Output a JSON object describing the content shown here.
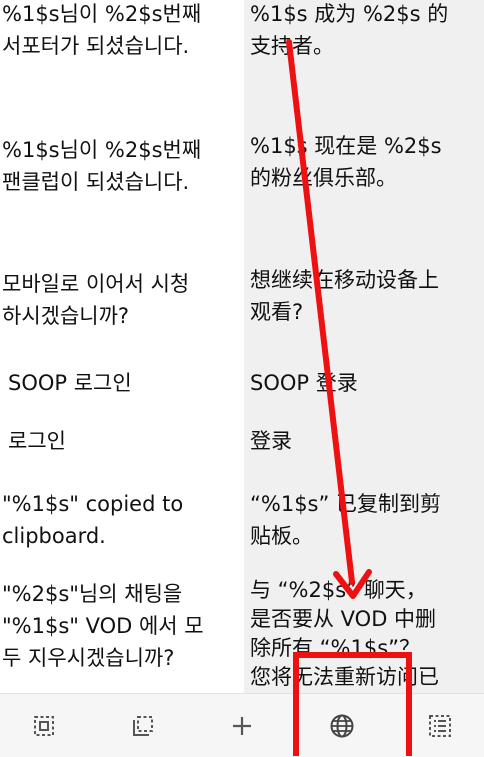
{
  "rows": [
    {
      "ko": "%1$s님이 %2$s번째\n서포터가 되셨습니다.",
      "zh": "%1$s 成为 %2$s 的\n支持者。"
    },
    {
      "ko": "%1$s님이 %2$s번째\n팬클럽이 되셨습니다.",
      "zh": "%1$s 现在是 %2$s\n的粉丝俱乐部。"
    },
    {
      "ko": "모바일로 이어서 시청\n하시겠습니까?",
      "zh": "想继续在移动设备上\n观看?"
    },
    {
      "ko": "SOOP 로그인",
      "zh": "SOOP 登录"
    },
    {
      "ko": "로그인",
      "zh": "登录"
    },
    {
      "ko": "\"%1$s\" copied to\nclipboard.",
      "zh": "“%1$s” 已复制到剪\n贴板。"
    },
    {
      "ko": "\"%2$s\"님의 채팅을\n\"%1$s\" VOD 에서 모\n두 지우시겠습니까?",
      "zh": "与 “%2$s” 聊天，\n是否要从 VOD 中删\n除所有 “%1$s”？\n您将无法重新访问已"
    }
  ],
  "toolbar": {
    "buttons": [
      {
        "name": "select-frame-icon"
      },
      {
        "name": "crop-frame-icon"
      },
      {
        "name": "add-icon"
      },
      {
        "name": "globe-icon"
      },
      {
        "name": "list-icon"
      }
    ]
  },
  "annotation_color": "#ee1111"
}
